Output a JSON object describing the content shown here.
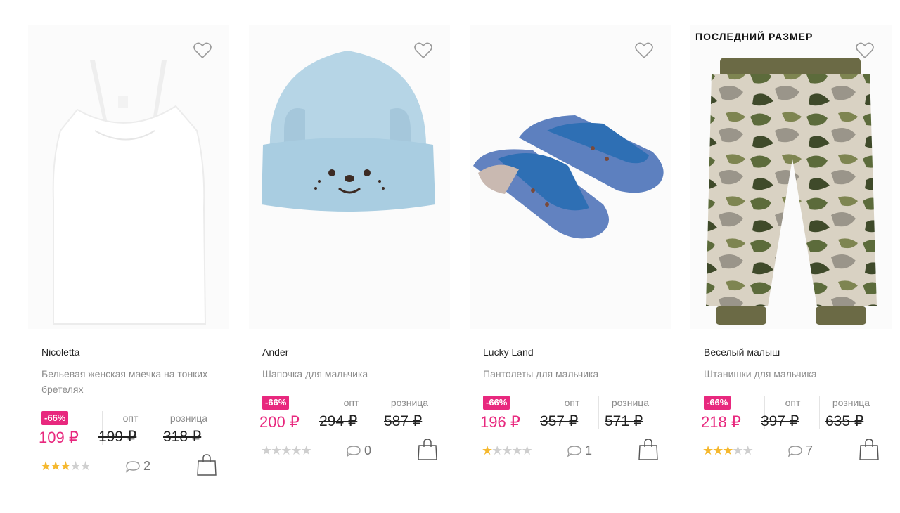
{
  "badge_last_size": "ПОСЛЕДНИЙ РАЗМЕР",
  "products": [
    {
      "brand": "Nicoletta",
      "description": "Бельевая женская маечка на тонких бретелях",
      "discount": "-66%",
      "price": "109 ₽",
      "opt_label": "опт",
      "opt_price": "199 ₽",
      "retail_label": "розница",
      "retail_price": "318 ₽",
      "rating": 3,
      "comments": "2",
      "icons": {
        "favorite": "heart-icon",
        "comments": "comment-icon",
        "cart": "shopping-bag-icon"
      }
    },
    {
      "brand": "Ander",
      "description": "Шапочка для мальчика",
      "discount": "-66%",
      "price": "200 ₽",
      "opt_label": "опт",
      "opt_price": "294 ₽",
      "retail_label": "розница",
      "retail_price": "587 ₽",
      "rating": 0,
      "comments": "0",
      "icons": {
        "favorite": "heart-icon",
        "comments": "comment-icon",
        "cart": "shopping-bag-icon"
      }
    },
    {
      "brand": "Lucky Land",
      "description": "Пантолеты для мальчика",
      "discount": "-66%",
      "price": "196 ₽",
      "opt_label": "опт",
      "opt_price": "357 ₽",
      "retail_label": "розница",
      "retail_price": "571 ₽",
      "rating": 1,
      "comments": "1",
      "icons": {
        "favorite": "heart-icon",
        "comments": "comment-icon",
        "cart": "shopping-bag-icon"
      }
    },
    {
      "brand": "Веселый малыш",
      "description": "Штанишки для мальчика",
      "discount": "-66%",
      "price": "218 ₽",
      "opt_label": "опт",
      "opt_price": "397 ₽",
      "retail_label": "розница",
      "retail_price": "635 ₽",
      "rating": 3,
      "comments": "7",
      "icons": {
        "favorite": "heart-icon",
        "comments": "comment-icon",
        "cart": "shopping-bag-icon"
      }
    }
  ],
  "colors": {
    "accent": "#e8287e",
    "star": "#f5b82e",
    "star_off": "#cfcfcf",
    "muted": "#8c8c8c"
  }
}
